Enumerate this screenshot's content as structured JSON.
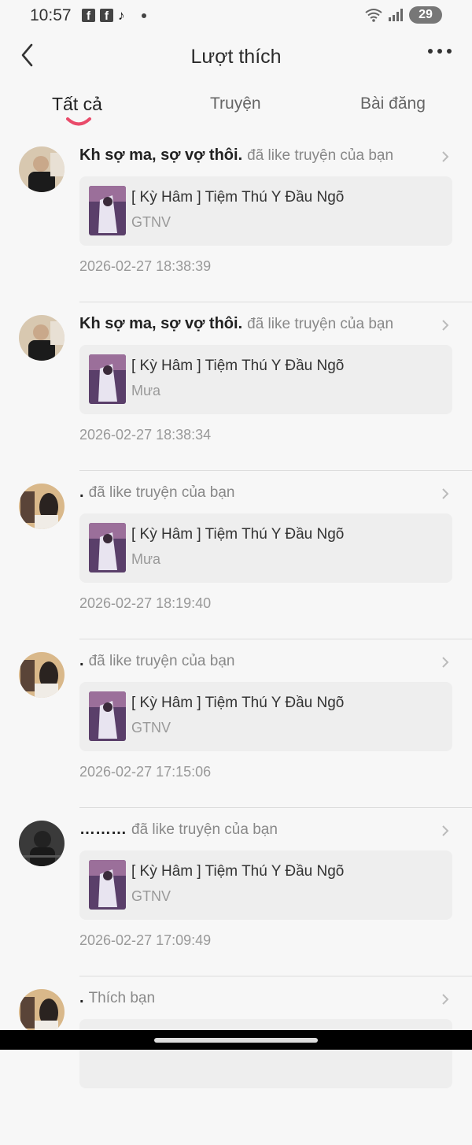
{
  "status": {
    "time": "10:57",
    "battery": "29",
    "fb_letter": "f"
  },
  "header": {
    "title": "Lượt thích"
  },
  "tabs": [
    {
      "label": "Tất cả"
    },
    {
      "label": "Truyện"
    },
    {
      "label": "Bài đăng"
    }
  ],
  "colors": {
    "accent": "#e94b6a",
    "background": "#f7f7f7",
    "card": "#eeeeee"
  },
  "items": [
    {
      "user": "Kh sợ ma, sợ vợ thôi.",
      "action": "đã like truyện của bạn",
      "title": "[ Kỳ Hâm ] Tiệm Thú Y Đầu Ngõ",
      "author": "GTNV",
      "time": "2026-02-27 18:38:39"
    },
    {
      "user": "Kh sợ ma, sợ vợ thôi.",
      "action": "đã like truyện của bạn",
      "title": "[ Kỳ Hâm ] Tiệm Thú Y Đầu Ngõ",
      "author": "Mưa",
      "time": "2026-02-27 18:38:34"
    },
    {
      "user": ".",
      "action": "đã like truyện của bạn",
      "title": "[ Kỳ Hâm ] Tiệm Thú Y Đầu Ngõ",
      "author": "Mưa",
      "time": "2026-02-27 18:19:40"
    },
    {
      "user": ".",
      "action": "đã like truyện của bạn",
      "title": "[ Kỳ Hâm ] Tiệm Thú Y Đầu Ngõ",
      "author": "GTNV",
      "time": "2026-02-27 17:15:06"
    },
    {
      "user": "………",
      "action": "đã like truyện của bạn",
      "title": "[ Kỳ Hâm ] Tiệm Thú Y Đầu Ngõ",
      "author": "GTNV",
      "time": "2026-02-27 17:09:49"
    },
    {
      "user": ".",
      "action": "Thích bạn"
    }
  ]
}
